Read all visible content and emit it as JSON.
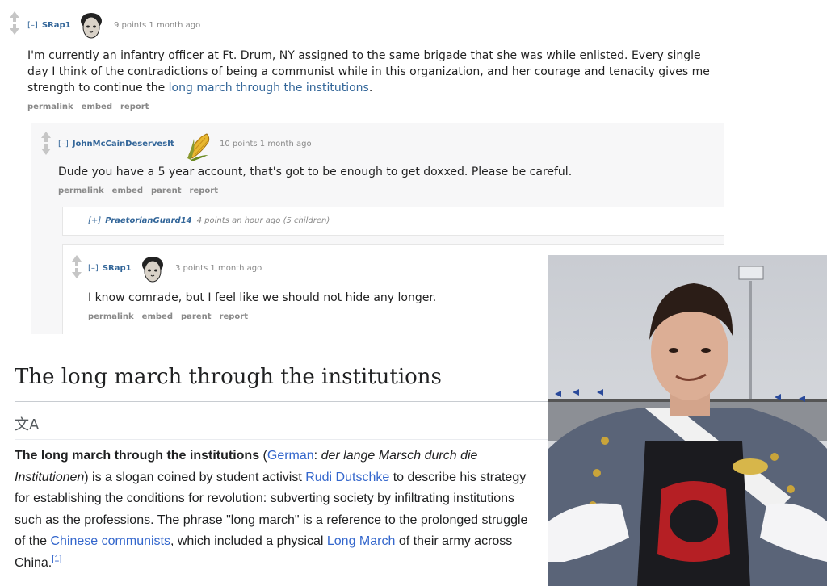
{
  "comments": {
    "c1": {
      "toggle": "[–]",
      "author": "SRap1",
      "meta": "9 points 1 month ago",
      "body_text": "I'm currently an infantry officer at Ft. Drum, NY assigned to the same brigade that she was while enlisted. Every single day I think of the contradictions of being a communist while in this organization, and her courage and tenacity gives me strength to continue the ",
      "body_link": "long march through the institutions",
      "body_end": ".",
      "buttons": [
        "permalink",
        "embed",
        "report"
      ]
    },
    "c2": {
      "toggle": "[–]",
      "author": "JohnMcCainDeservesIt",
      "meta": "10 points 1 month ago",
      "body_text": "Dude you have a 5 year account, that's got to be enough to get doxxed. Please be careful.",
      "buttons": [
        "permalink",
        "embed",
        "parent",
        "report"
      ]
    },
    "c3": {
      "toggle": "[+]",
      "author": "PraetorianGuard14",
      "meta": "4 points an hour ago (5 children)"
    },
    "c4": {
      "toggle": "[–]",
      "author": "SRap1",
      "meta": "3 points 1 month ago",
      "body_text": "I know comrade, but I feel like we should not hide any longer.",
      "buttons": [
        "permalink",
        "embed",
        "parent",
        "report"
      ]
    }
  },
  "wiki": {
    "title": "The long march through the institutions",
    "lang_icon": "文A",
    "p_bold": "The long march through the institutions",
    "p_open": " (",
    "p_german": "German",
    "p_colon": ": ",
    "p_german_phrase": "der lange Marsch durch die Institutionen",
    "p_mid1": ") is a slogan coined by student activist ",
    "p_link_rudi": "Rudi Dutschke",
    "p_mid2": " to describe his strategy for establishing the conditions for revolution: subverting society by infiltrating institutions such as the professions. The phrase \"long march\" is a reference to the prolonged struggle of the ",
    "p_link_chinese": "Chinese communists",
    "p_mid3": ", which included a physical ",
    "p_link_longmarch": "Long March",
    "p_mid4": " of their army across China.",
    "p_ref": "[1]"
  },
  "colors": {
    "link": "#3366cc",
    "reddit_link": "#336699",
    "author": "#336699"
  }
}
